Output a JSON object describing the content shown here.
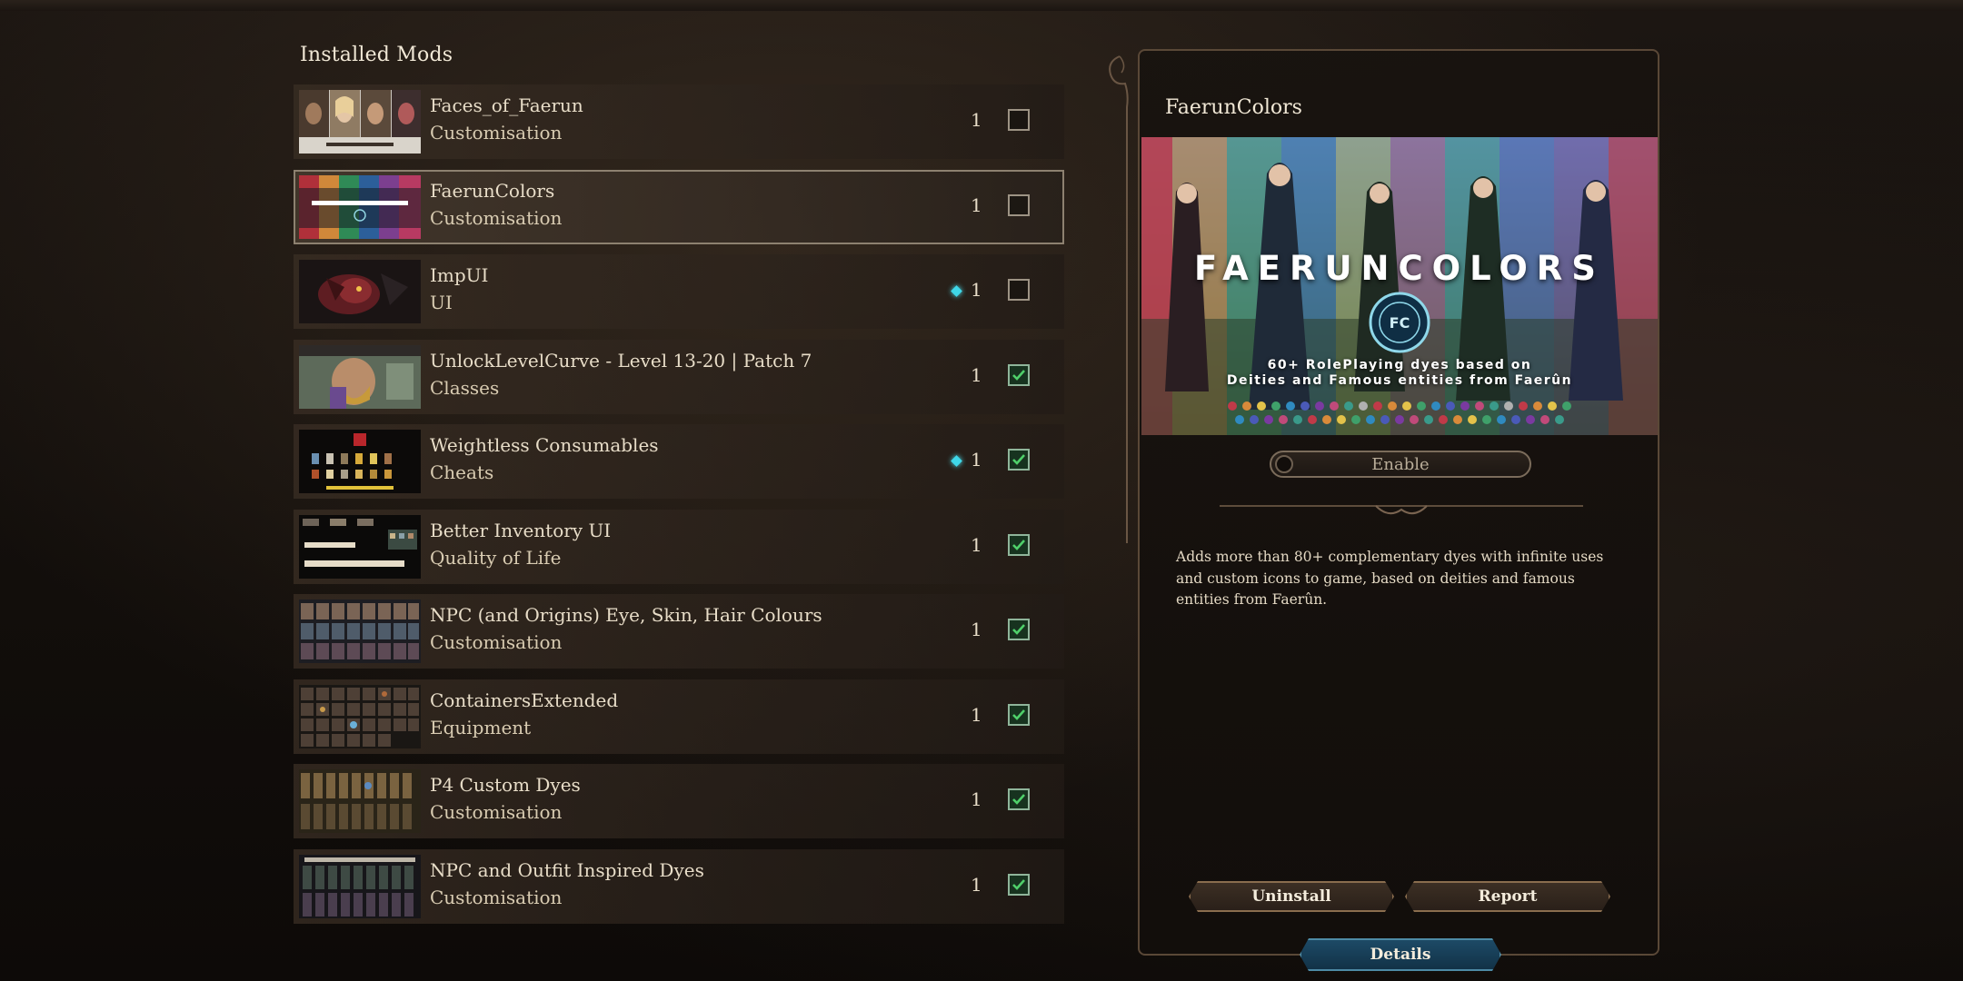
{
  "list": {
    "title": "Installed Mods"
  },
  "mods": [
    {
      "name": "Faces_of_Faerun",
      "category": "Customisation",
      "version": "1",
      "enabled": false,
      "new": false,
      "selected": false
    },
    {
      "name": "FaerunColors",
      "category": "Customisation",
      "version": "1",
      "enabled": false,
      "new": false,
      "selected": true
    },
    {
      "name": "ImpUI",
      "category": "UI",
      "version": "1",
      "enabled": false,
      "new": true,
      "selected": false
    },
    {
      "name": "UnlockLevelCurve - Level 13-20 | Patch 7",
      "category": "Classes",
      "version": "1",
      "enabled": true,
      "new": false,
      "selected": false
    },
    {
      "name": "Weightless Consumables",
      "category": "Cheats",
      "version": "1",
      "enabled": true,
      "new": true,
      "selected": false
    },
    {
      "name": "Better Inventory UI",
      "category": "Quality of Life",
      "version": "1",
      "enabled": true,
      "new": false,
      "selected": false
    },
    {
      "name": "NPC (and Origins) Eye, Skin, Hair Colours",
      "category": "Customisation",
      "version": "1",
      "enabled": true,
      "new": false,
      "selected": false
    },
    {
      "name": "ContainersExtended",
      "category": "Equipment",
      "version": "1",
      "enabled": true,
      "new": false,
      "selected": false
    },
    {
      "name": "P4 Custom Dyes",
      "category": "Customisation",
      "version": "1",
      "enabled": true,
      "new": false,
      "selected": false
    },
    {
      "name": "NPC and Outfit Inspired Dyes",
      "category": "Customisation",
      "version": "1",
      "enabled": true,
      "new": false,
      "selected": false
    }
  ],
  "detail": {
    "title": "FaerunColors",
    "banner_title": "FAERUNCOLORS",
    "banner_subtitle_line1": "60+ RolePlaying dyes based on",
    "banner_subtitle_line2": "Deities and Famous entities from Faerûn",
    "toggle_label": "Enable",
    "toggle_on": false,
    "description": "Adds more than 80+ complementary dyes with infinite uses and custom icons to game, based on deities and famous entities from Faerûn."
  },
  "buttons": {
    "uninstall": "Uninstall",
    "report": "Report",
    "details_tab": "Details"
  },
  "colors": {
    "accent_cyan": "#3fd7e8",
    "check_green": "#4fd06a",
    "panel_border": "#5a4837",
    "tab_blue": "#1d4a66"
  }
}
